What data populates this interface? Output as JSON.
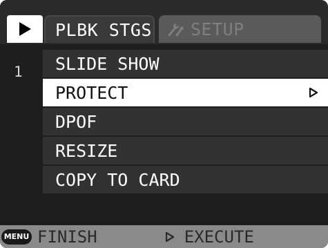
{
  "tabs": {
    "playback_icon": "play-icon",
    "active_label": "PLBK STGS",
    "inactive_label": "SETUP",
    "inactive_icon": "wrench-icon"
  },
  "page_indicator": "1",
  "menu": {
    "items": [
      {
        "label": "SLIDE SHOW"
      },
      {
        "label": "PROTECT",
        "selected": true,
        "arrow_icon": "right-arrow-icon"
      },
      {
        "label": "DPOF"
      },
      {
        "label": "RESIZE"
      },
      {
        "label": "COPY TO CARD"
      }
    ]
  },
  "footer": {
    "menu_button_label": "MENU",
    "finish_label": "FINISH",
    "execute_icon": "right-arrow-icon",
    "execute_label": "EXECUTE"
  },
  "colors": {
    "background": "#1e1e1e",
    "selected_row": "#ffffff",
    "footer_bar": "#8a8a8a"
  }
}
